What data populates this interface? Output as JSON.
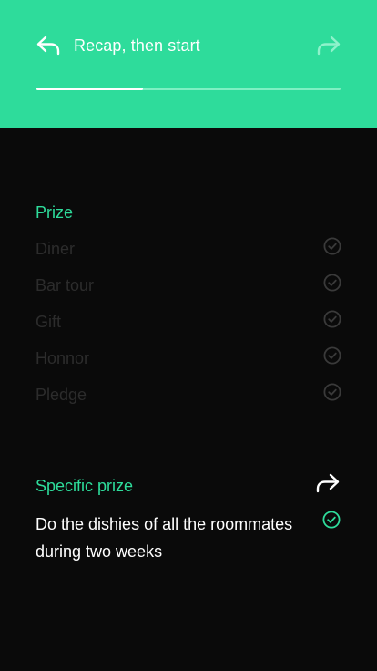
{
  "header": {
    "title": "Recap, then start",
    "back_icon": "reply-arrow-icon",
    "next_icon": "forward-arrow-icon",
    "progress": 0.35,
    "colors": {
      "background": "#2edc9b",
      "progress_track": "#7ff0c3",
      "progress_fill": "#ffffff"
    }
  },
  "prize_section": {
    "title": "Prize",
    "items": [
      {
        "label": "Diner",
        "icon": "check-circle-icon"
      },
      {
        "label": "Bar tour",
        "icon": "check-circle-icon"
      },
      {
        "label": "Gift",
        "icon": "check-circle-icon"
      },
      {
        "label": "Honnor",
        "icon": "check-circle-icon"
      },
      {
        "label": "Pledge",
        "icon": "check-circle-icon"
      }
    ]
  },
  "specific_section": {
    "title": "Specific prize",
    "text": "Do the dishies of all the roommates during two weeks",
    "action_icon": "forward-arrow-icon",
    "status_icon": "check-circle-icon"
  },
  "colors": {
    "accent": "#2edc9b",
    "background": "#0a0a0a",
    "muted_text": "#2c2c2c",
    "text": "#ffffff"
  }
}
